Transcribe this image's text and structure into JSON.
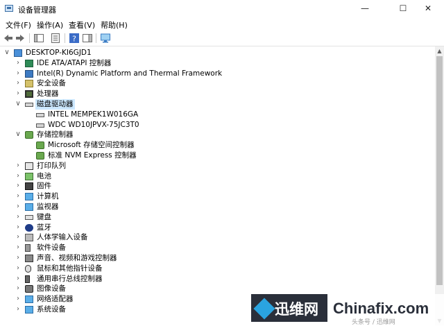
{
  "window": {
    "title": "设备管理器",
    "minimize_glyph": "—",
    "maximize_glyph": "☐",
    "close_glyph": "✕"
  },
  "menu": [
    "文件(F)",
    "操作(A)",
    "查看(V)",
    "帮助(H)"
  ],
  "toolbar": [
    "back-icon",
    "forward-icon",
    "properties-icon",
    "console-tree-icon",
    "help-icon",
    "action-pane-icon",
    "monitor-icon"
  ],
  "tree": {
    "root": "DESKTOP-KI6GJD1",
    "nodes": [
      {
        "label": "IDE ATA/ATAPI 控制器",
        "icon": "ide-controller-icon"
      },
      {
        "label": "Intel(R) Dynamic Platform and Thermal Framework",
        "icon": "intel-dptf-icon"
      },
      {
        "label": "安全设备",
        "icon": "security-device-icon"
      },
      {
        "label": "处理器",
        "icon": "processor-icon"
      },
      {
        "label": "磁盘驱动器",
        "icon": "disk-drive-icon",
        "expanded": true,
        "selected": true,
        "children": [
          {
            "label": "INTEL MEMPEK1W016GA",
            "icon": "disk-icon"
          },
          {
            "label": "WDC WD10JPVX-75JC3T0",
            "icon": "disk-icon"
          }
        ]
      },
      {
        "label": "存储控制器",
        "icon": "storage-controller-icon",
        "expanded": true,
        "children": [
          {
            "label": "Microsoft 存储空间控制器",
            "icon": "storage-controller-icon"
          },
          {
            "label": "标准 NVM Express 控制器",
            "icon": "storage-controller-icon"
          }
        ]
      },
      {
        "label": "打印队列",
        "icon": "printer-icon"
      },
      {
        "label": "电池",
        "icon": "battery-icon"
      },
      {
        "label": "固件",
        "icon": "firmware-icon"
      },
      {
        "label": "计算机",
        "icon": "computer-icon"
      },
      {
        "label": "监视器",
        "icon": "monitor-icon"
      },
      {
        "label": "键盘",
        "icon": "keyboard-icon"
      },
      {
        "label": "蓝牙",
        "icon": "bluetooth-icon"
      },
      {
        "label": "人体学输入设备",
        "icon": "hid-icon"
      },
      {
        "label": "软件设备",
        "icon": "software-device-icon"
      },
      {
        "label": "声音、视频和游戏控制器",
        "icon": "sound-icon"
      },
      {
        "label": "鼠标和其他指针设备",
        "icon": "mouse-icon"
      },
      {
        "label": "通用串行总线控制器",
        "icon": "usb-icon"
      },
      {
        "label": "图像设备",
        "icon": "camera-icon"
      },
      {
        "label": "网络适配器",
        "icon": "network-adapter-icon"
      },
      {
        "label": "系统设备",
        "icon": "system-device-icon"
      }
    ]
  },
  "watermark": {
    "cn": "迅维网",
    "en": "Chinafix.com",
    "sub": "头条号 / 迅维网"
  },
  "colors": {
    "selection": "#cce8ff",
    "watermark_dark": "#2a2f3a",
    "watermark_accent": "#2aa4e0"
  }
}
